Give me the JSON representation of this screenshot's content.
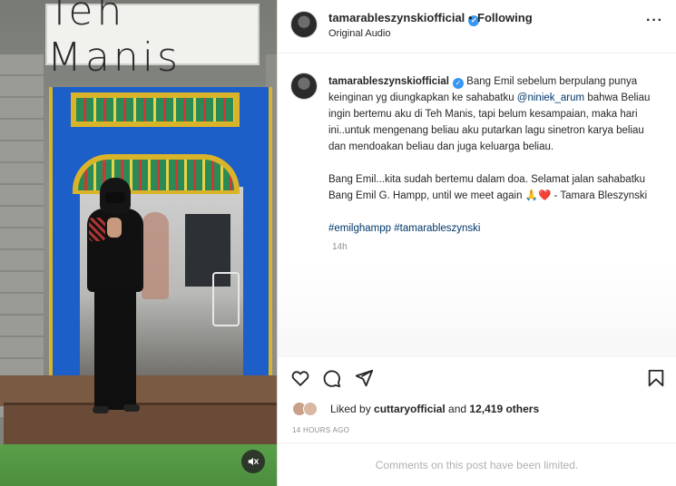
{
  "photo": {
    "sign_text": "Teh Manis",
    "alt": "Woman in black standing in a blue doorway"
  },
  "header": {
    "username": "tamarableszynskiofficial",
    "separator": "•",
    "follow_state": "Following",
    "audio": "Original Audio",
    "more": "···"
  },
  "caption": {
    "username": "tamarableszynskiofficial",
    "paragraph1_a": "Bang Emil sebelum berpulang punya keinginan yg diungkapkan ke sahabatku ",
    "mention": "@niniek_arum",
    "paragraph1_b": " bahwa Beliau ingin bertemu aku di Teh Manis, tapi belum kesampaian, maka hari ini..untuk mengenang beliau aku putarkan lagu sinetron karya beliau dan mendoakan beliau dan juga keluarga beliau.",
    "paragraph2": "Bang Emil...kita sudah bertemu dalam doa. Selamat jalan sahabatku Bang Emil G. Hampp, until we meet again 🙏❤️ - Tamara Bleszynski",
    "hashtag1": "#emilghampp",
    "hashtag2": "#tamarableszynski",
    "time": "14h"
  },
  "likes": {
    "prefix": "Liked by ",
    "liker": "cuttaryofficial",
    "middle": " and ",
    "count": "12,419 others"
  },
  "posted": "14 HOURS AGO",
  "comments_notice": "Comments on this post have been limited.",
  "colors": {
    "link": "#00376b",
    "verified": "#3897f0",
    "muted": "#8e8e8e",
    "door_blue": "#1c5fc9"
  }
}
